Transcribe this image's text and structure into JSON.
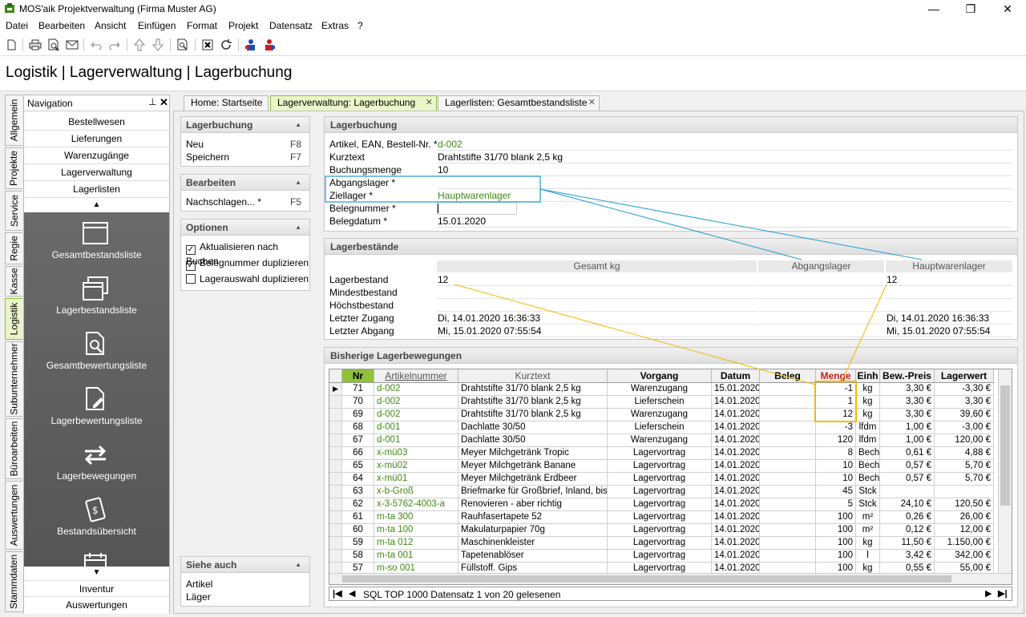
{
  "window": {
    "title": "MOS'aik Projektverwaltung (Firma Muster AG)",
    "minimize": "—",
    "maximize": "❐",
    "close": "✕"
  },
  "menu": [
    "Datei",
    "Bearbeiten",
    "Ansicht",
    "Einfügen",
    "Format",
    "Projekt",
    "Datensatz",
    "Extras",
    "?"
  ],
  "page_title": "Logistik | Lagerverwaltung | Lagerbuchung",
  "vertical_tabs": [
    "Allgemein",
    "Projekte",
    "Service",
    "Regie",
    "Kasse",
    "Logistik",
    "Subunternehmer",
    "Büroarbeiten",
    "Auswertungen",
    "Stammdaten"
  ],
  "navigation": {
    "title": "Navigation",
    "links_top": [
      "Bestellwesen",
      "Lieferungen",
      "Warenzugänge",
      "Lagerverwaltung",
      "Lagerlisten"
    ],
    "big_items": [
      "Gesamtbestandsliste",
      "Lagerbestandsliste",
      "Gesamtbewertungsliste",
      "Lagerbewertungsliste",
      "Lagerbewegungen",
      "Bestandsübersicht"
    ],
    "links_bottom": [
      "Inventur",
      "Auswertungen"
    ]
  },
  "doc_tabs": [
    "Home: Startseite",
    "Lagerverwaltung: Lagerbuchung",
    "Lagerlisten: Gesamtbestandsliste"
  ],
  "left_panels": {
    "lagerbuchung": {
      "title": "Lagerbuchung",
      "items": [
        {
          "label": "Neu",
          "key": "F8"
        },
        {
          "label": "Speichern",
          "key": "F7"
        }
      ]
    },
    "bearbeiten": {
      "title": "Bearbeiten",
      "items": [
        {
          "label": "Nachschlagen... *",
          "key": "F5"
        }
      ]
    },
    "optionen": {
      "title": "Optionen",
      "items": [
        {
          "label": "Aktualisieren nach Buchen",
          "checked": true
        },
        {
          "label": "Belegnummer duplizieren",
          "checked": true
        },
        {
          "label": "Lagerauswahl duplizieren",
          "checked": false
        }
      ]
    },
    "siehe_auch": {
      "title": "Siehe auch",
      "items": [
        "Artikel",
        "Läger"
      ]
    }
  },
  "form": {
    "title": "Lagerbuchung",
    "fields": [
      {
        "label": "Artikel, EAN, Bestell-Nr. *",
        "value": "d-002"
      },
      {
        "label": "Kurztext",
        "value": "Drahtstifte 31/70 blank 2,5 kg"
      },
      {
        "label": "Buchungsmenge",
        "value": "10"
      },
      {
        "label": "Abgangslager *",
        "value": ""
      },
      {
        "label": "Ziellager *",
        "value": "Hauptwarenlager"
      },
      {
        "label": "Belegnummer *",
        "value": ""
      },
      {
        "label": "Belegdatum *",
        "value": "15.01.2020"
      }
    ]
  },
  "bestaende": {
    "title": "Lagerbestände",
    "columns": [
      "Gesamt kg",
      "Abgangslager",
      "Hauptwarenlager"
    ],
    "rows": [
      {
        "label": "Lagerbestand",
        "values": [
          "12",
          "",
          "12"
        ]
      },
      {
        "label": "Mindestbestand",
        "values": [
          "",
          "",
          ""
        ]
      },
      {
        "label": "Höchstbestand",
        "values": [
          "",
          "",
          ""
        ]
      },
      {
        "label": "Letzter Zugang",
        "values": [
          "Di, 14.01.2020 16:36:33",
          "",
          "Di, 14.01.2020 16:36:33"
        ]
      },
      {
        "label": "Letzter Abgang",
        "values": [
          "Mi, 15.01.2020 07:55:54",
          "",
          "Mi, 15.01.2020 07:55:54"
        ]
      }
    ]
  },
  "bewegungen": {
    "title": "Bisherige Lagerbewegungen",
    "columns": [
      "Nr",
      "Artikelnummer",
      "Kurztext",
      "Vorgang",
      "Datum",
      "Beleg",
      "Menge",
      "Einh",
      "Bew.-Preis",
      "Lagerwert"
    ],
    "rows": [
      [
        "71",
        "d-002",
        "Drahtstifte 31/70 blank 2,5 kg",
        "Warenzugang",
        "15.01.2020",
        "",
        "-1",
        "kg",
        "3,30 €",
        "-3,30 €"
      ],
      [
        "70",
        "d-002",
        "Drahtstifte 31/70 blank 2,5 kg",
        "Lieferschein",
        "14.01.2020",
        "",
        "1",
        "kg",
        "3,30 €",
        "3,30 €"
      ],
      [
        "69",
        "d-002",
        "Drahtstifte 31/70 blank 2,5 kg",
        "Warenzugang",
        "14.01.2020",
        "",
        "12",
        "kg",
        "3,30 €",
        "39,60 €"
      ],
      [
        "68",
        "d-001",
        "Dachlatte 30/50",
        "Lieferschein",
        "14.01.2020",
        "",
        "-3",
        "lfdm",
        "1,00 €",
        "-3,00 €"
      ],
      [
        "67",
        "d-001",
        "Dachlatte 30/50",
        "Warenzugang",
        "14.01.2020",
        "",
        "120",
        "lfdm",
        "1,00 €",
        "120,00 €"
      ],
      [
        "66",
        "x-mü03",
        "Meyer Milchgetränk Tropic",
        "Lagervortrag",
        "14.01.2020",
        "",
        "8",
        "Bech",
        "0,61 €",
        "4,88 €"
      ],
      [
        "65",
        "x-mü02",
        "Meyer Milchgetränk Banane",
        "Lagervortrag",
        "14.01.2020",
        "",
        "10",
        "Bech",
        "0,57 €",
        "5,70 €"
      ],
      [
        "64",
        "x-mü01",
        "Meyer Milchgetränk Erdbeer",
        "Lagervortrag",
        "14.01.2020",
        "",
        "10",
        "Bech",
        "0,57 €",
        "5,70 €"
      ],
      [
        "63",
        "x-b-Groß",
        "Briefmarke für Großbrief, Inland, bis",
        "Lagervortrag",
        "14.01.2020",
        "",
        "45",
        "Stck",
        "",
        ""
      ],
      [
        "62",
        "x-3-5762-4003-a",
        "Renovieren - aber richtig",
        "Lagervortrag",
        "14.01.2020",
        "",
        "5",
        "Stck",
        "24,10 €",
        "120,50 €"
      ],
      [
        "61",
        "m-ta 300",
        "Rauhfasertapete 52",
        "Lagervortrag",
        "14.01.2020",
        "",
        "100",
        "m²",
        "0,26 €",
        "26,00 €"
      ],
      [
        "60",
        "m-ta 100",
        "Makulaturpapier 70g",
        "Lagervortrag",
        "14.01.2020",
        "",
        "100",
        "m²",
        "0,12 €",
        "12,00 €"
      ],
      [
        "59",
        "m-ta 012",
        "Maschinenkleister",
        "Lagervortrag",
        "14.01.2020",
        "",
        "100",
        "kg",
        "11,50 €",
        "1.150,00 €"
      ],
      [
        "58",
        "m-ta 001",
        "Tapetenablöser",
        "Lagervortrag",
        "14.01.2020",
        "",
        "100",
        "l",
        "3,42 €",
        "342,00 €"
      ],
      [
        "57",
        "m-so 001",
        "Füllstoff. Gips",
        "Lagervortrag",
        "14.01.2020",
        "",
        "100",
        "kg",
        "0,55 €",
        "55,00 €"
      ]
    ],
    "status": "SQL TOP 1000 Datensatz 1 von 20 gelesenen"
  },
  "colors": {
    "accent_green": "#3c8b12",
    "highlight_blue": "#1f9bd1",
    "highlight_orange": "#f5b800",
    "active_tab": "#eaf6c8"
  }
}
